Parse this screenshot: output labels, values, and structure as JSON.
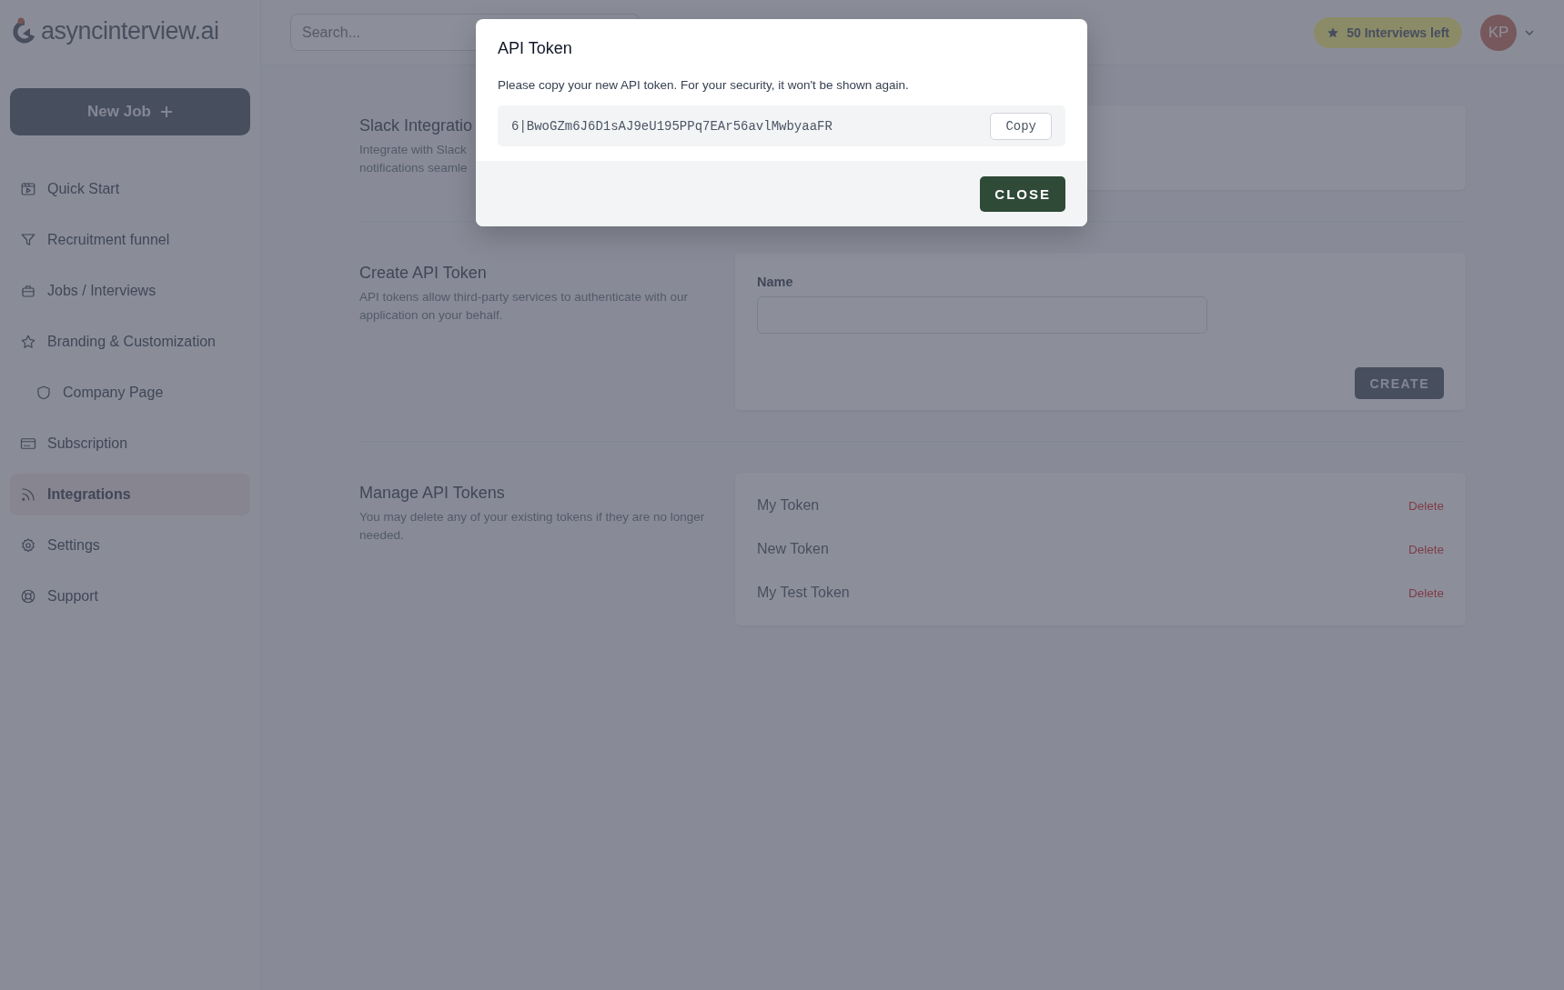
{
  "logo": {
    "text": "asyncinterview.ai"
  },
  "sidebar": {
    "new_job_button": "New Job",
    "items": [
      {
        "label": "Quick Start",
        "selected": false
      },
      {
        "label": "Recruitment funnel",
        "selected": false
      },
      {
        "label": "Jobs / Interviews",
        "selected": false
      },
      {
        "label": "Branding & Customization",
        "selected": false,
        "children": [
          {
            "label": "Company Page",
            "selected": false
          }
        ]
      },
      {
        "label": "Subscription",
        "selected": false
      },
      {
        "label": "Integrations",
        "selected": true
      },
      {
        "label": "Settings",
        "selected": false
      },
      {
        "label": "Support",
        "selected": false
      }
    ]
  },
  "topbar": {
    "search": {
      "placeholder": "Search..."
    },
    "badge": "50 Interviews left",
    "avatar": "KP"
  },
  "sections": [
    {
      "kind": "empty",
      "title": "Slack Integratio",
      "description_lines": [
        "Integrate with Slack",
        "notifications seamle"
      ]
    },
    {
      "kind": "form",
      "title": "Create API Token",
      "description": "API tokens allow third-party services to authenticate with our application on your behalf.",
      "field_label": "Name",
      "button": "CREATE"
    },
    {
      "kind": "list",
      "title": "Manage API Tokens",
      "description": "You may delete any of your existing tokens if they are no longer needed.",
      "tokens": [
        {
          "name": "My Token",
          "action": "Delete"
        },
        {
          "name": "New Token",
          "action": "Delete"
        },
        {
          "name": "My Test Token",
          "action": "Delete"
        }
      ]
    }
  ],
  "modal": {
    "title": "API Token",
    "message": "Please copy your new API token. For your security, it won't be shown again.",
    "token": "6|BwoGZm6J6D1sAJ9eU195PPq7EAr56avlMwbyaaFR",
    "copy_button": "Copy",
    "close_button": "CLOSE"
  }
}
